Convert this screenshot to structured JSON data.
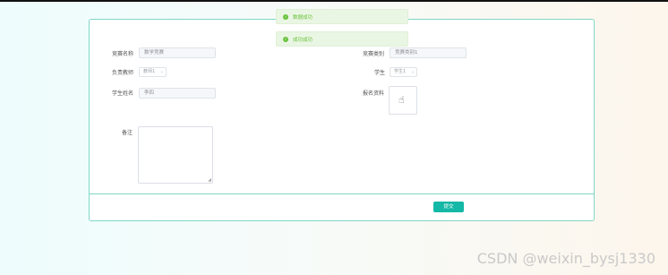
{
  "form": {
    "competition_name": {
      "label": "竞赛名称",
      "value": "数学竞赛"
    },
    "competition_type": {
      "label": "竞赛类别",
      "value": "竞赛类别1"
    },
    "teacher": {
      "label": "负责教师",
      "value": "教师1"
    },
    "student": {
      "label": "学生",
      "value": "学生1"
    },
    "student_name": {
      "label": "学生姓名",
      "value": "李四"
    },
    "registration_material": {
      "label": "报名资料"
    },
    "remark": {
      "label": "备注",
      "value": ""
    },
    "submit_label": "提交"
  },
  "toasts": [
    {
      "message": "数据成功"
    },
    {
      "message": "成功成功"
    }
  ],
  "watermark": "CSDN @weixin_bysj1330",
  "colors": {
    "accent": "#14b8a6",
    "success": "#67c23a",
    "border": "#7fd6c8"
  },
  "icons": [
    "hand-pointer-icon",
    "check-circle-icon",
    "chevron-down-icon"
  ]
}
